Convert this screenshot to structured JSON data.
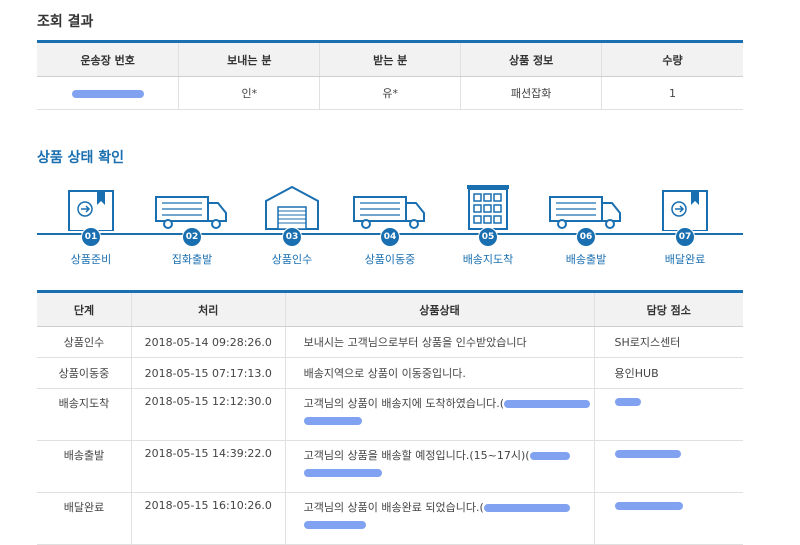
{
  "section1": {
    "title": "조회 결과"
  },
  "result": {
    "headers": [
      "운송장 번호",
      "보내는 분",
      "받는 분",
      "상품 정보",
      "수량"
    ],
    "row": {
      "tracking": "",
      "sender": "인*",
      "receiver": "유*",
      "product": "패션잡화",
      "qty": "1"
    }
  },
  "section2": {
    "title": "상품 상태 확인"
  },
  "steps": [
    {
      "num": "01",
      "label": "상품준비",
      "icon": "box-icon"
    },
    {
      "num": "02",
      "label": "집화출발",
      "icon": "truck-icon"
    },
    {
      "num": "03",
      "label": "상품인수",
      "icon": "warehouse-icon"
    },
    {
      "num": "04",
      "label": "상품이동중",
      "icon": "truck-icon"
    },
    {
      "num": "05",
      "label": "배송지도착",
      "icon": "building-icon"
    },
    {
      "num": "06",
      "label": "배송출발",
      "icon": "truck-icon"
    },
    {
      "num": "07",
      "label": "배달완료",
      "icon": "box-icon"
    }
  ],
  "history": {
    "headers": [
      "단계",
      "처리",
      "상품상태",
      "담당 점소"
    ],
    "rows": [
      {
        "stage": "상품인수",
        "time": "2018-05-14 09:28:26.0",
        "status": "보내시는 고객님으로부터 상품을 인수받았습니다",
        "office": "SH로지스센터"
      },
      {
        "stage": "상품이동중",
        "time": "2018-05-15 07:17:13.0",
        "status": "배송지역으로 상품이 이동중입니다.",
        "office": "용인HUB"
      },
      {
        "stage": "배송지도착",
        "time": "2018-05-15 12:12:30.0",
        "status": "고객님의 상품이 배송지에 도착하였습니다.(",
        "office": ""
      },
      {
        "stage": "배송출발",
        "time": "2018-05-15 14:39:22.0",
        "status": "고객님의 상품을 배송할 예정입니다.(15~17시)(",
        "office": ""
      },
      {
        "stage": "배달완료",
        "time": "2018-05-15 16:10:26.0",
        "status": "고객님의 상품이 배송완료 되었습니다.(",
        "office": ""
      }
    ]
  },
  "colors": {
    "accent": "#1a6fb0",
    "redaction": "#6a92ee"
  }
}
